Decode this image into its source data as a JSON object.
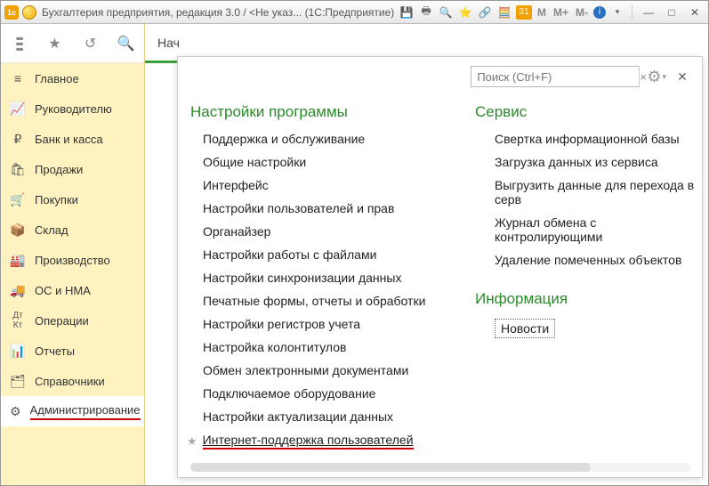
{
  "titlebar": {
    "title": "Бухгалтерия предприятия, редакция 3.0 / <Не указ...   (1С:Предприятие)"
  },
  "toolbar_top": {
    "m1": "M",
    "m2": "M+",
    "m3": "M-"
  },
  "tab_stub": "Нач",
  "sidebar": {
    "items": [
      {
        "label": "Главное",
        "icon": "menu-icon"
      },
      {
        "label": "Руководителю",
        "icon": "trend-icon"
      },
      {
        "label": "Банк и касса",
        "icon": "ruble-icon"
      },
      {
        "label": "Продажи",
        "icon": "bag-icon"
      },
      {
        "label": "Покупки",
        "icon": "cart-icon"
      },
      {
        "label": "Склад",
        "icon": "box-icon"
      },
      {
        "label": "Производство",
        "icon": "factory-icon"
      },
      {
        "label": "ОС и НМА",
        "icon": "truck-icon"
      },
      {
        "label": "Операции",
        "icon": "ops-icon"
      },
      {
        "label": "Отчеты",
        "icon": "report-icon"
      },
      {
        "label": "Справочники",
        "icon": "folder-icon"
      },
      {
        "label": "Администрирование",
        "icon": "gear-icon",
        "active": true
      }
    ]
  },
  "panel": {
    "search_placeholder": "Поиск (Ctrl+F)",
    "left": {
      "title": "Настройки программы",
      "items": [
        "Поддержка и обслуживание",
        "Общие настройки",
        "Интерфейс",
        "Настройки пользователей и прав",
        "Органайзер",
        "Настройки работы с файлами",
        "Настройки синхронизации данных",
        "Печатные формы, отчеты и обработки",
        "Настройки регистров учета",
        "Настройка колонтитулов",
        "Обмен электронными документами",
        "Подключаемое оборудование",
        "Настройки актуализации данных",
        "Интернет-поддержка пользователей"
      ]
    },
    "right": {
      "service_title": "Сервис",
      "service_items": [
        "Свертка информационной базы",
        "Загрузка данных из сервиса",
        "Выгрузить данные для перехода в серв",
        "Журнал обмена с контролирующими",
        "Удаление помеченных объектов"
      ],
      "info_title": "Информация",
      "info_items": [
        "Новости"
      ]
    }
  }
}
